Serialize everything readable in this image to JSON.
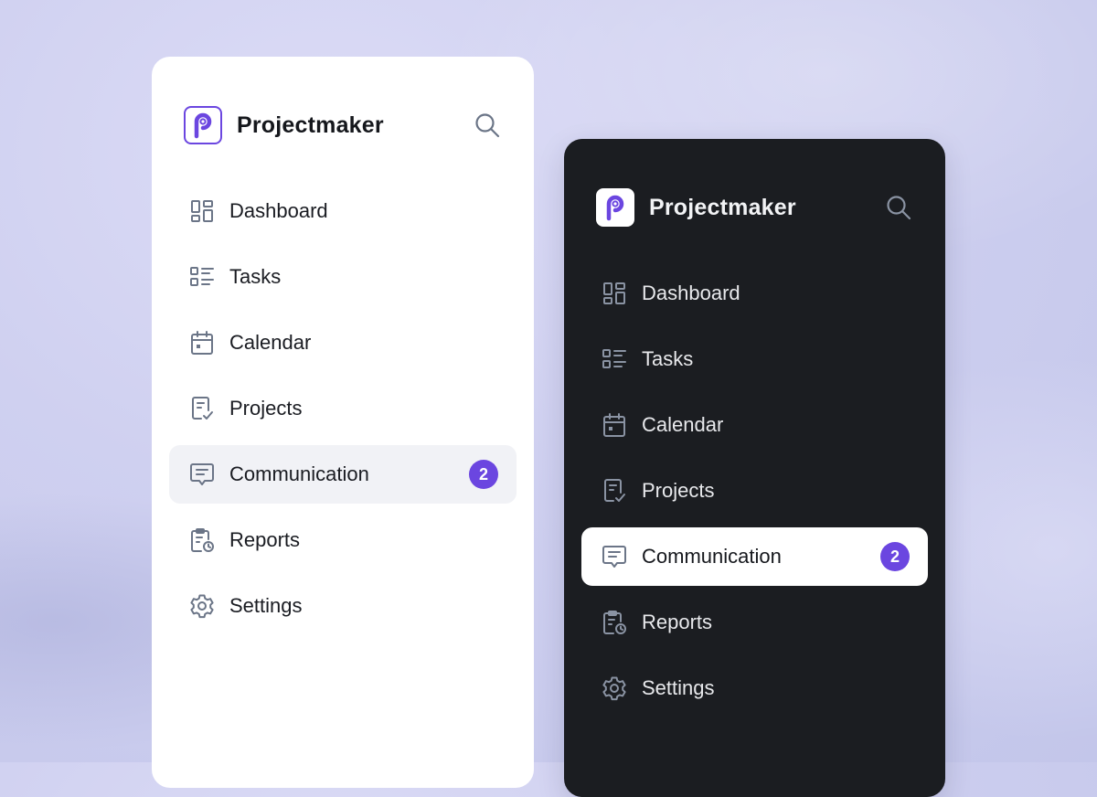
{
  "app": {
    "name": "Projectmaker"
  },
  "nav": {
    "items": [
      {
        "label": "Dashboard",
        "icon": "dashboard-icon"
      },
      {
        "label": "Tasks",
        "icon": "tasks-icon"
      },
      {
        "label": "Calendar",
        "icon": "calendar-icon"
      },
      {
        "label": "Projects",
        "icon": "projects-icon"
      },
      {
        "label": "Communication",
        "icon": "chat-icon",
        "badge": "2",
        "active": true
      },
      {
        "label": "Reports",
        "icon": "reports-icon"
      },
      {
        "label": "Settings",
        "icon": "gear-icon"
      }
    ]
  },
  "theme": {
    "accent": "#6b46e0",
    "light_panel_bg": "#ffffff",
    "dark_panel_bg": "#1b1d21",
    "light_active_bg": "#f1f2f6",
    "dark_active_bg": "#ffffff",
    "icon_color": "#6b7587"
  }
}
